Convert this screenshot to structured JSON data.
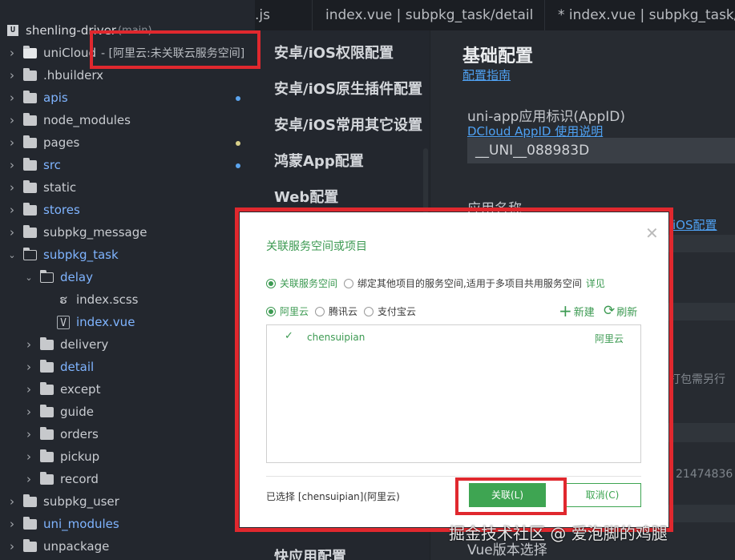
{
  "project": {
    "name": "shenling-driver",
    "branch": "(main)",
    "icon": "U"
  },
  "tree": [
    {
      "label": "uniCloud",
      "tag": "- [阿里云:未关联云服务空间]",
      "kind": "folder-cloud",
      "depth": 0,
      "expanded": false
    },
    {
      "label": ".hbuilderx",
      "kind": "folder",
      "depth": 0
    },
    {
      "label": "apis",
      "kind": "folder",
      "depth": 0,
      "modified": true,
      "dot": "blue"
    },
    {
      "label": "node_modules",
      "kind": "folder",
      "depth": 0
    },
    {
      "label": "pages",
      "kind": "folder",
      "depth": 0,
      "dot": "yellow"
    },
    {
      "label": "src",
      "kind": "folder",
      "depth": 0,
      "modified": true,
      "dot": "blue"
    },
    {
      "label": "static",
      "kind": "folder",
      "depth": 0
    },
    {
      "label": "stores",
      "kind": "folder",
      "depth": 0,
      "modified": true
    },
    {
      "label": "subpkg_message",
      "kind": "folder",
      "depth": 0
    },
    {
      "label": "subpkg_task",
      "kind": "folder",
      "depth": 0,
      "expanded": true,
      "modified": true
    },
    {
      "label": "delay",
      "kind": "folder",
      "depth": 1,
      "expanded": true,
      "modified": true
    },
    {
      "label": "index.scss",
      "kind": "file-sass",
      "depth": 2
    },
    {
      "label": "index.vue",
      "kind": "file-vue",
      "depth": 2,
      "modified": true
    },
    {
      "label": "delivery",
      "kind": "folder",
      "depth": 1
    },
    {
      "label": "detail",
      "kind": "folder",
      "depth": 1,
      "modified": true
    },
    {
      "label": "except",
      "kind": "folder",
      "depth": 1
    },
    {
      "label": "guide",
      "kind": "folder",
      "depth": 1
    },
    {
      "label": "orders",
      "kind": "folder",
      "depth": 1
    },
    {
      "label": "pickup",
      "kind": "folder",
      "depth": 1
    },
    {
      "label": "record",
      "kind": "folder",
      "depth": 1
    },
    {
      "label": "subpkg_user",
      "kind": "folder",
      "depth": 0
    },
    {
      "label": "uni_modules",
      "kind": "folder",
      "depth": 0,
      "modified": true
    },
    {
      "label": "unpackage",
      "kind": "folder",
      "depth": 0
    }
  ],
  "tabs": [
    ".js",
    "index.vue | subpkg_task/detail",
    "* index.vue | subpkg_task/detail"
  ],
  "nav": [
    "安卓/iOS权限配置",
    "安卓/iOS原生插件配置",
    "安卓/iOS常用其它设置",
    "鸿蒙App配置",
    "Web配置",
    "快应用配置"
  ],
  "panel": {
    "title": "基础配置",
    "guide_link": "配置指南",
    "appid_label": "uni-app应用标识(AppID)",
    "appid_link": "DCloud AppID 使用说明",
    "appid_value": "__UNI__088983D",
    "name_label": "应用名称",
    "ios_link": "iOS配置",
    "side_text_1": "打包需另行",
    "side_text_2": "21474836",
    "vue_label": "Vue版本选择"
  },
  "dialog": {
    "title": "关联服务空间或项目",
    "mode_options": [
      "关联服务空间",
      "绑定其他项目的服务空间,适用于多项目共用服务空间"
    ],
    "mode_detail_link": "详见",
    "providers": [
      "阿里云",
      "腾讯云",
      "支付宝云"
    ],
    "new_label": "新建",
    "refresh_label": "刷新",
    "spaces": [
      {
        "name": "chensuipian",
        "provider": "阿里云"
      }
    ],
    "selected_text": "已选择 [chensuipian](阿里云)",
    "confirm_label": "关联(L)",
    "cancel_label": "取消(C)",
    "close_glyph": "✕"
  },
  "watermark": "掘金技术社区 @ 爱泡脚的鸡腿",
  "colors": {
    "accent_green": "#3ea552",
    "highlight_red": "#e0282e",
    "link_blue": "#4fa1f2",
    "modified_blue": "#7fb4ff"
  }
}
